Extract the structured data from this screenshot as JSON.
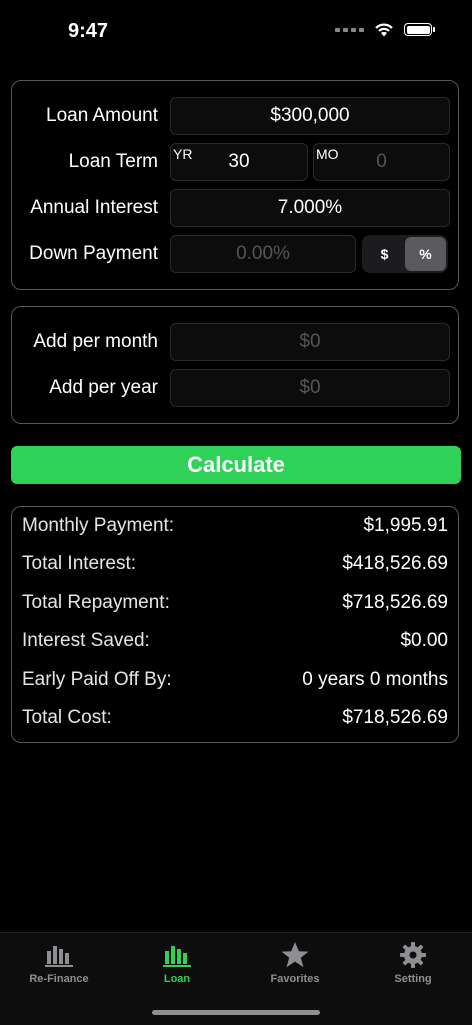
{
  "status": {
    "time": "9:47"
  },
  "loan": {
    "amount_label": "Loan Amount",
    "amount_value": "$300,000",
    "term_label": "Loan Term",
    "term_years_prefix": "YR",
    "term_years_value": "30",
    "term_months_prefix": "MO",
    "term_months_placeholder": "0",
    "interest_label": "Annual Interest",
    "interest_value": "7.000%",
    "down_label": "Down Payment",
    "down_placeholder": "0.00%",
    "down_mode_options": [
      "$",
      "%"
    ],
    "down_mode_selected": "%"
  },
  "extra": {
    "per_month_label": "Add per month",
    "per_month_placeholder": "$0",
    "per_year_label": "Add per year",
    "per_year_placeholder": "$0"
  },
  "calculate_label": "Calculate",
  "results": [
    {
      "label": "Monthly Payment:",
      "value": "$1,995.91"
    },
    {
      "label": "Total Interest:",
      "value": "$418,526.69"
    },
    {
      "label": "Total Repayment:",
      "value": "$718,526.69"
    },
    {
      "label": "Interest Saved:",
      "value": "$0.00"
    },
    {
      "label": "Early Paid Off By:",
      "value": "0 years 0 months"
    },
    {
      "label": "Total Cost:",
      "value": "$718,526.69"
    }
  ],
  "tabs": [
    {
      "label": "Re-Finance",
      "icon": "bar-chart-icon",
      "active": false
    },
    {
      "label": "Loan",
      "icon": "bar-chart-icon",
      "active": true
    },
    {
      "label": "Favorites",
      "icon": "star-icon",
      "active": false
    },
    {
      "label": "Setting",
      "icon": "gear-icon",
      "active": false
    }
  ],
  "colors": {
    "accent": "#30d158",
    "inactive_tab": "#8e8e93",
    "background": "#000000"
  }
}
